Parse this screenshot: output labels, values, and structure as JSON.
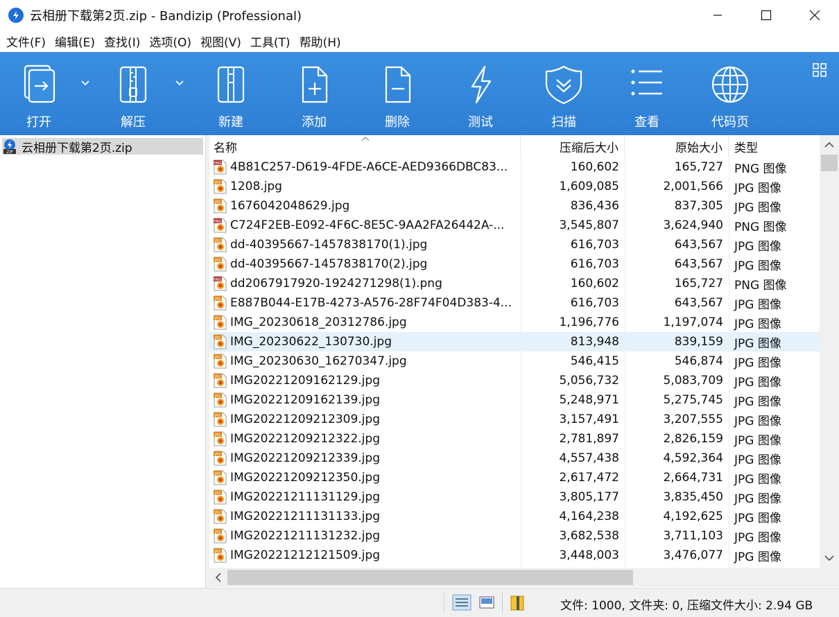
{
  "window": {
    "title": "云相册下载第2页.zip - Bandizip (Professional)"
  },
  "menu": [
    "文件(F)",
    "编辑(E)",
    "查找(I)",
    "选项(O)",
    "视图(V)",
    "工具(T)",
    "帮助(H)"
  ],
  "toolbar": {
    "open": "打开",
    "extract": "解压",
    "new": "新建",
    "add": "添加",
    "delete": "删除",
    "test": "测试",
    "scan": "扫描",
    "view": "查看",
    "codepage": "代码页"
  },
  "tree": {
    "archive": "云相册下载第2页.zip"
  },
  "columns": {
    "name": "名称",
    "compressed": "压缩后大小",
    "original": "原始大小",
    "type": "类型"
  },
  "files": [
    {
      "name": "4B81C257-D619-4FDE-A6CE-AED9366DBC83...",
      "compressed": "160,602",
      "original": "165,727",
      "type": "PNG 图像",
      "icon": "png"
    },
    {
      "name": "1208.jpg",
      "compressed": "1,609,085",
      "original": "2,001,566",
      "type": "JPG 图像",
      "icon": "jpg"
    },
    {
      "name": "1676042048629.jpg",
      "compressed": "836,436",
      "original": "837,305",
      "type": "JPG 图像",
      "icon": "jpg"
    },
    {
      "name": "C724F2EB-E092-4F6C-8E5C-9AA2FA26442A-...",
      "compressed": "3,545,807",
      "original": "3,624,940",
      "type": "PNG 图像",
      "icon": "png"
    },
    {
      "name": "dd-40395667-1457838170(1).jpg",
      "compressed": "616,703",
      "original": "643,567",
      "type": "JPG 图像",
      "icon": "jpg"
    },
    {
      "name": "dd-40395667-1457838170(2).jpg",
      "compressed": "616,703",
      "original": "643,567",
      "type": "JPG 图像",
      "icon": "jpg"
    },
    {
      "name": "dd2067917920-1924271298(1).png",
      "compressed": "160,602",
      "original": "165,727",
      "type": "PNG 图像",
      "icon": "png"
    },
    {
      "name": "E887B044-E17B-4273-A576-28F74F04D383-4...",
      "compressed": "616,703",
      "original": "643,567",
      "type": "JPG 图像",
      "icon": "jpg"
    },
    {
      "name": "IMG_20230618_20312786.jpg",
      "compressed": "1,196,776",
      "original": "1,197,074",
      "type": "JPG 图像",
      "icon": "jpg"
    },
    {
      "name": "IMG_20230622_130730.jpg",
      "compressed": "813,948",
      "original": "839,159",
      "type": "JPG 图像",
      "icon": "jpg",
      "selected": true
    },
    {
      "name": "IMG_20230630_16270347.jpg",
      "compressed": "546,415",
      "original": "546,874",
      "type": "JPG 图像",
      "icon": "jpg"
    },
    {
      "name": "IMG20221209162129.jpg",
      "compressed": "5,056,732",
      "original": "5,083,709",
      "type": "JPG 图像",
      "icon": "jpg"
    },
    {
      "name": "IMG20221209162139.jpg",
      "compressed": "5,248,971",
      "original": "5,275,745",
      "type": "JPG 图像",
      "icon": "jpg"
    },
    {
      "name": "IMG20221209212309.jpg",
      "compressed": "3,157,491",
      "original": "3,207,555",
      "type": "JPG 图像",
      "icon": "jpg"
    },
    {
      "name": "IMG20221209212322.jpg",
      "compressed": "2,781,897",
      "original": "2,826,159",
      "type": "JPG 图像",
      "icon": "jpg"
    },
    {
      "name": "IMG20221209212339.jpg",
      "compressed": "4,557,438",
      "original": "4,592,364",
      "type": "JPG 图像",
      "icon": "jpg"
    },
    {
      "name": "IMG20221209212350.jpg",
      "compressed": "2,617,472",
      "original": "2,664,731",
      "type": "JPG 图像",
      "icon": "jpg"
    },
    {
      "name": "IMG20221211131129.jpg",
      "compressed": "3,805,177",
      "original": "3,835,450",
      "type": "JPG 图像",
      "icon": "jpg"
    },
    {
      "name": "IMG20221211131133.jpg",
      "compressed": "4,164,238",
      "original": "4,192,625",
      "type": "JPG 图像",
      "icon": "jpg"
    },
    {
      "name": "IMG20221211131232.jpg",
      "compressed": "3,682,538",
      "original": "3,711,103",
      "type": "JPG 图像",
      "icon": "jpg"
    },
    {
      "name": "IMG20221212121509.jpg",
      "compressed": "3,448,003",
      "original": "3,476,077",
      "type": "JPG 图像",
      "icon": "jpg"
    }
  ],
  "status": {
    "text": "文件: 1000, 文件夹: 0, 压缩文件大小: 2.94 GB"
  },
  "colors": {
    "toolbar": "#3a8fe0",
    "selected_row": "#e5f1fb",
    "png_icon": "#b03a3a",
    "jpg_icon": "#e08a1e"
  }
}
